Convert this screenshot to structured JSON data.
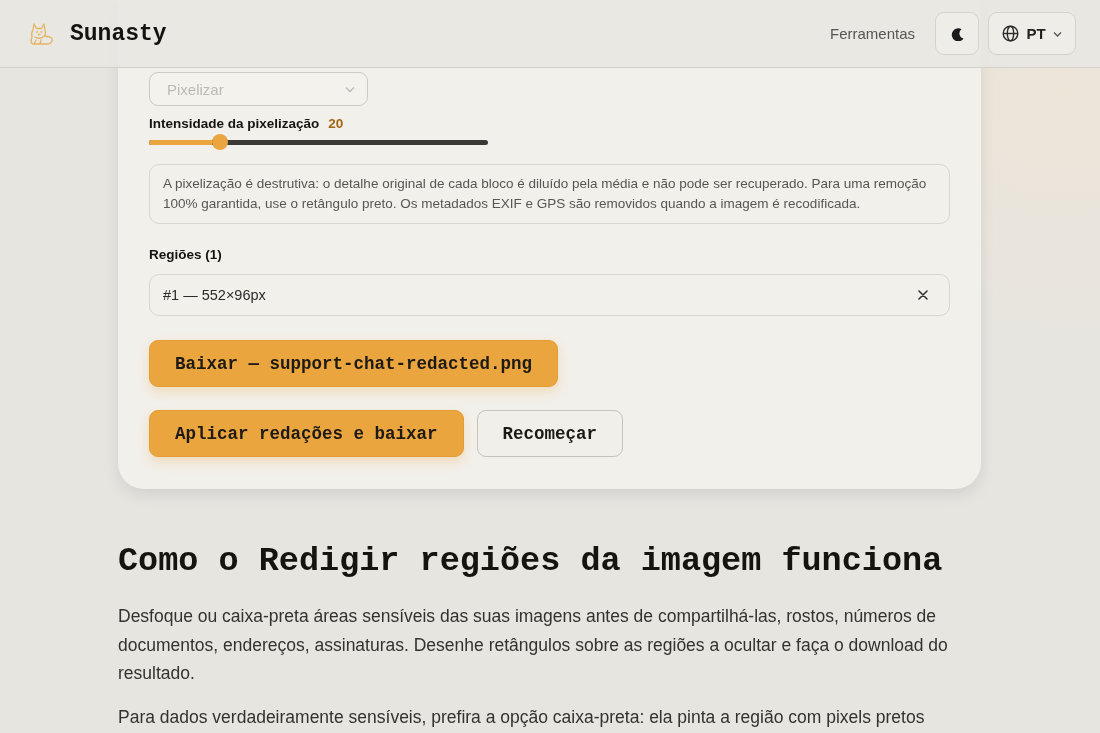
{
  "header": {
    "brand": "Sunasty",
    "nav": [
      {
        "label": "Ferramentas"
      }
    ],
    "language": "PT"
  },
  "tool": {
    "mode_select": {
      "value": "Pixelizar"
    },
    "intensity": {
      "label": "Intensidade da pixelização",
      "value": "20",
      "level": 0.21
    },
    "notice": "A pixelização é destrutiva: o detalhe original de cada bloco é diluído pela média e não pode ser recuperado. Para uma remoção 100% garantida, use o retângulo preto. Os metadados EXIF e GPS são removidos quando a imagem é recodificada.",
    "regions": {
      "title": "Regiões (1)",
      "items": [
        {
          "label": "#1 — 552×96px"
        }
      ]
    },
    "download_button": "Baixar — support-chat-redacted.png",
    "actions": [
      {
        "label": "Aplicar redações e baixar",
        "kind": "primary"
      },
      {
        "label": "Recomeçar",
        "kind": "secondary"
      }
    ]
  },
  "article": {
    "heading": "Como o Redigir regiões da imagem funciona",
    "paragraphs": [
      "Desfoque ou caixa-preta áreas sensíveis das suas imagens antes de compartilhá-las, rostos, números de documentos, endereços, assinaturas. Desenhe retângulos sobre as regiões a ocultar e faça o download do resultado.",
      "Para dados verdadeiramente sensíveis, prefira a opção caixa-preta: ela pinta a região com pixels pretos"
    ]
  }
}
